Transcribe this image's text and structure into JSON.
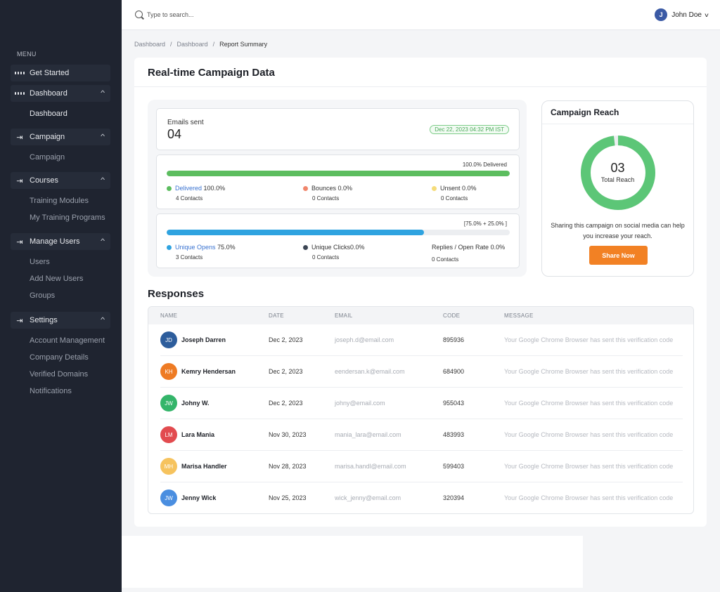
{
  "sidebar": {
    "menu_label": "MENU",
    "get_started": "Get Started",
    "groups": [
      {
        "label": "Dashboard",
        "items": [
          "Dashboard"
        ]
      },
      {
        "label": "Campaign",
        "items": [
          "Campaign"
        ]
      },
      {
        "label": "Courses",
        "items": [
          "Training Modules",
          "My Training Programs"
        ]
      },
      {
        "label": "Manage Users",
        "items": [
          "Users",
          "Add New Users",
          "Groups"
        ]
      },
      {
        "label": "Settings",
        "items": [
          "Account Management",
          "Company Details",
          "Verified Domains",
          "Notifications"
        ]
      }
    ]
  },
  "topbar": {
    "search_placeholder": "Type to search...",
    "user_initial": "J",
    "user_name": "John Doe"
  },
  "breadcrumb": [
    "Dashboard",
    "Dashboard",
    "Report Summary"
  ],
  "main": {
    "title": "Real-time Campaign Data",
    "emails_label": "Emails sent",
    "emails_count": "04",
    "date_badge": "Dec 22, 2023 04:32 PM IST",
    "delivery": {
      "bar_label": "100.0% Delivered",
      "fill_fraction": 1.0,
      "fill_color": "#5cbd5f",
      "stats": [
        {
          "name": "Delivered",
          "value": "100.0%",
          "sub": "4 Contacts",
          "color": "#5cbd5f",
          "link": true
        },
        {
          "name": "Bounces",
          "value": "0.0%",
          "sub": "0 Contacts",
          "color": "#f0866c",
          "link": false
        },
        {
          "name": "Unsent",
          "value": "0.0%",
          "sub": "0 Contacts",
          "color": "#f5dc7a",
          "link": false
        }
      ]
    },
    "engagement": {
      "bar_label": "[75.0% + 25.0% ]",
      "fill_fraction": 0.75,
      "fill_color": "#2fa3e0",
      "stats": [
        {
          "name": "Unique Opens",
          "value": "75.0%",
          "sub": "3 Contacts",
          "color": "#2fa3e0",
          "link": true
        },
        {
          "name": "Unique Clicks",
          "value": "0.0%",
          "sub": "0 Contacts",
          "color": "#3c4654",
          "link": false
        },
        {
          "name": "Replies / Open Rate",
          "value": "0.0%",
          "sub": "0 Contacts",
          "color": "",
          "link": false
        }
      ]
    }
  },
  "reach": {
    "title": "Campaign Reach",
    "value": "03",
    "label": "Total Reach",
    "fill_fraction": 0.98,
    "ring_color": "#5cc677",
    "text": "Sharing this campaign on social media can help you increase your reach.",
    "button": "Share Now"
  },
  "responses": {
    "title": "Responses",
    "columns": [
      "NAME",
      "DATE",
      "EMAIL",
      "CODE",
      "MESSAGE"
    ],
    "rows": [
      {
        "initials": "JD",
        "color": "#2d5d9c",
        "name": "Joseph Darren",
        "date": "Dec 2, 2023",
        "email": "joseph.d@email.com",
        "code": "895936",
        "message": "Your Google Chrome Browser has sent this verification code"
      },
      {
        "initials": "KH",
        "color": "#ee7b24",
        "name": "Kemry Hendersan",
        "date": "Dec 2, 2023",
        "email": "eendersan.k@email.com",
        "code": "684900",
        "message": "Your Google Chrome Browser has sent this verification code"
      },
      {
        "initials": "JW",
        "color": "#34b56a",
        "name": "Johny W.",
        "date": "Dec 2, 2023",
        "email": "johny@email.com",
        "code": "955043",
        "message": "Your Google Chrome Browser has sent this verification code"
      },
      {
        "initials": "LM",
        "color": "#e24b4f",
        "name": "Lara Mania",
        "date": "Nov 30, 2023",
        "email": "mania_lara@email.com",
        "code": "483993",
        "message": "Your Google Chrome Browser has sent this verification code"
      },
      {
        "initials": "MH",
        "color": "#f6c35e",
        "name": "Marisa Handler",
        "date": "Nov 28, 2023",
        "email": "marisa.handl@email.com",
        "code": "599403",
        "message": "Your Google Chrome Browser has sent this verification code"
      },
      {
        "initials": "JW",
        "color": "#4a8ee0",
        "name": "Jenny Wick",
        "date": "Nov 25, 2023",
        "email": "wick_jenny@email.com",
        "code": "320394",
        "message": "Your Google Chrome Browser has sent this verification code"
      }
    ]
  }
}
